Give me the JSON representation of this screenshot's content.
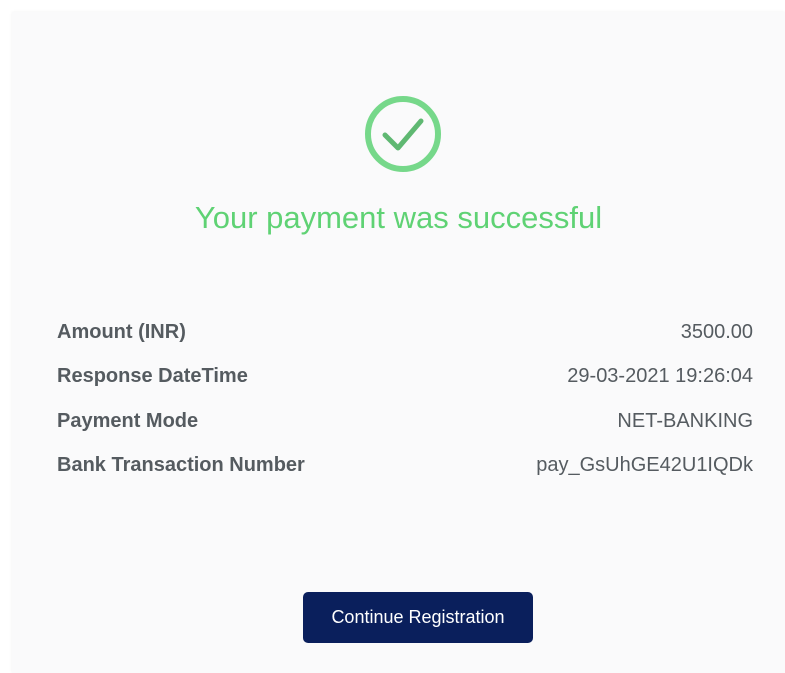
{
  "status": {
    "icon": "check-circle-icon",
    "message": "Your payment was successful",
    "color": "#5fd274"
  },
  "details": [
    {
      "label": "Amount (INR)",
      "value": "3500.00"
    },
    {
      "label": "Response DateTime",
      "value": "29-03-2021 19:26:04"
    },
    {
      "label": "Payment Mode",
      "value": "NET-BANKING"
    },
    {
      "label": "Bank Transaction Number",
      "value": "pay_GsUhGE42U1IQDk"
    }
  ],
  "actions": {
    "continue_label": "Continue Registration",
    "button_color": "#0a1f5c"
  }
}
